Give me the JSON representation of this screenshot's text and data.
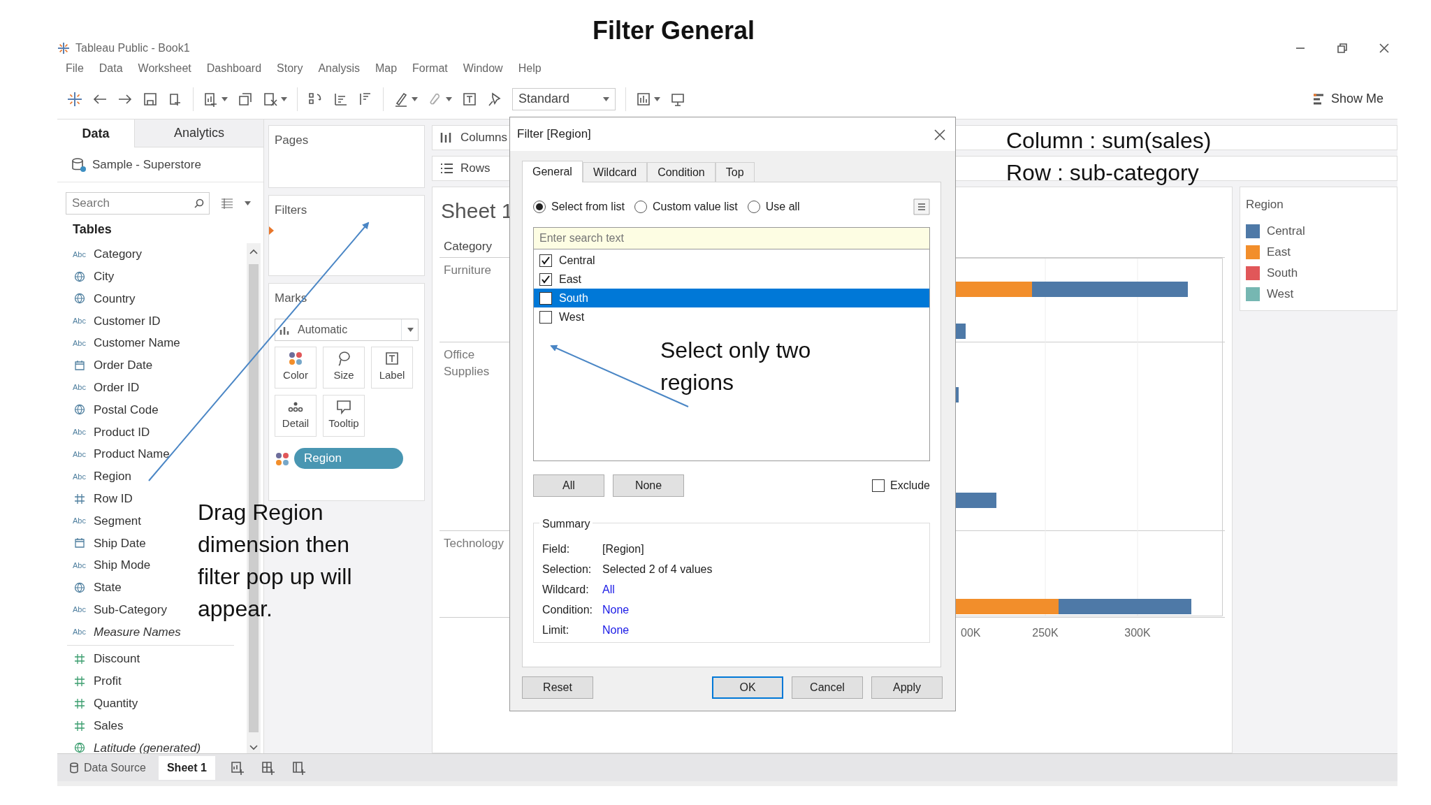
{
  "slide_title": "Filter General",
  "window": {
    "title": "Tableau Public - Book1"
  },
  "menu": [
    "File",
    "Data",
    "Worksheet",
    "Dashboard",
    "Story",
    "Analysis",
    "Map",
    "Format",
    "Window",
    "Help"
  ],
  "toolbar": {
    "mark_size": "Standard",
    "show_me": "Show Me"
  },
  "data_pane": {
    "tabs": [
      {
        "label": "Data",
        "selected": true
      },
      {
        "label": "Analytics",
        "selected": false
      }
    ],
    "data_source": "Sample - Superstore",
    "search": {
      "placeholder": "Search"
    },
    "section": "Tables",
    "fields": [
      {
        "name": "Category",
        "kind": "string",
        "measure": false,
        "badge": "Abc",
        "italic": false
      },
      {
        "name": "City",
        "kind": "geo",
        "measure": false,
        "italic": false
      },
      {
        "name": "Country",
        "kind": "geo",
        "measure": false,
        "italic": false
      },
      {
        "name": "Customer ID",
        "kind": "string",
        "measure": false,
        "badge": "Abc",
        "italic": false
      },
      {
        "name": "Customer Name",
        "kind": "string",
        "measure": false,
        "badge": "Abc",
        "italic": false
      },
      {
        "name": "Order Date",
        "kind": "date",
        "measure": false,
        "italic": false
      },
      {
        "name": "Order ID",
        "kind": "string",
        "measure": false,
        "badge": "Abc",
        "italic": false
      },
      {
        "name": "Postal Code",
        "kind": "geo",
        "measure": false,
        "italic": false
      },
      {
        "name": "Product ID",
        "kind": "string",
        "measure": false,
        "badge": "Abc",
        "italic": false
      },
      {
        "name": "Product Name",
        "kind": "string",
        "measure": false,
        "badge": "Abc",
        "italic": false
      },
      {
        "name": "Region",
        "kind": "string",
        "measure": false,
        "badge": "Abc",
        "italic": false
      },
      {
        "name": "Row ID",
        "kind": "number",
        "measure": false,
        "italic": false
      },
      {
        "name": "Segment",
        "kind": "string",
        "measure": false,
        "badge": "Abc",
        "italic": false
      },
      {
        "name": "Ship Date",
        "kind": "date",
        "measure": false,
        "italic": false
      },
      {
        "name": "Ship Mode",
        "kind": "string",
        "measure": false,
        "badge": "Abc",
        "italic": false
      },
      {
        "name": "State",
        "kind": "geo",
        "measure": false,
        "italic": false
      },
      {
        "name": "Sub-Category",
        "kind": "string",
        "measure": false,
        "badge": "Abc",
        "italic": false
      },
      {
        "name": "Measure Names",
        "kind": "string",
        "measure": false,
        "badge": "Abc",
        "italic": true
      },
      {
        "name": "Discount",
        "kind": "number",
        "measure": true,
        "italic": false
      },
      {
        "name": "Profit",
        "kind": "number",
        "measure": true,
        "italic": false
      },
      {
        "name": "Quantity",
        "kind": "number",
        "measure": true,
        "italic": false
      },
      {
        "name": "Sales",
        "kind": "number",
        "measure": true,
        "italic": false
      },
      {
        "name": "Latitude (generated)",
        "kind": "geo",
        "measure": true,
        "italic": true
      }
    ]
  },
  "cards": {
    "pages": "Pages",
    "filters": "Filters",
    "marks": {
      "title": "Marks",
      "mark_type": "Automatic",
      "buttons": [
        "Color",
        "Size",
        "Label",
        "Detail",
        "Tooltip"
      ],
      "pill": "Region"
    }
  },
  "shelves": [
    "Columns",
    "Rows"
  ],
  "sheet": {
    "title": "Sheet 1",
    "header": "Category",
    "categories": [
      "Furniture",
      "Office Supplies",
      "Technology"
    ],
    "axis_ticks": [
      "00K",
      "250K",
      "300K"
    ]
  },
  "legend": {
    "title": "Region",
    "items": [
      {
        "label": "Central",
        "color": "#4e79a7"
      },
      {
        "label": "East",
        "color": "#f28e2b"
      },
      {
        "label": "South",
        "color": "#e15759"
      },
      {
        "label": "West",
        "color": "#76b7b2"
      }
    ]
  },
  "sheet_tabs": [
    {
      "label": "Data Source",
      "selected": false
    },
    {
      "label": "Sheet 1",
      "selected": true
    }
  ],
  "dialog": {
    "title": "Filter [Region]",
    "tabs": [
      {
        "label": "General",
        "selected": true
      },
      {
        "label": "Wildcard",
        "selected": false
      },
      {
        "label": "Condition",
        "selected": false
      },
      {
        "label": "Top",
        "selected": false
      }
    ],
    "modes": [
      {
        "label": "Select from list",
        "selected": true
      },
      {
        "label": "Custom value list",
        "selected": false
      },
      {
        "label": "Use all",
        "selected": false
      }
    ],
    "search": {
      "placeholder": "Enter search text"
    },
    "values": [
      {
        "label": "Central",
        "checked": true,
        "selected": false
      },
      {
        "label": "East",
        "checked": true,
        "selected": false
      },
      {
        "label": "South",
        "checked": false,
        "selected": true
      },
      {
        "label": "West",
        "checked": false,
        "selected": false
      }
    ],
    "list_buttons": [
      "All",
      "None"
    ],
    "exclude": {
      "label": "Exclude",
      "checked": false
    },
    "summary": {
      "title": "Summary",
      "rows": [
        {
          "label": "Field:",
          "value": "[Region]",
          "link": false
        },
        {
          "label": "Selection:",
          "value": "Selected 2 of 4 values",
          "link": false
        },
        {
          "label": "Wildcard:",
          "value": "All",
          "link": true
        },
        {
          "label": "Condition:",
          "value": "None",
          "link": true
        },
        {
          "label": "Limit:",
          "value": "None",
          "link": true
        }
      ]
    },
    "footer": [
      {
        "label": "Reset",
        "default": false
      },
      {
        "label": "OK",
        "default": true
      },
      {
        "label": "Cancel",
        "default": false
      },
      {
        "label": "Apply",
        "default": false
      }
    ]
  },
  "annotations": {
    "columns_note": "Column : sum(sales)",
    "rows_note": "Row : sub-category",
    "filter_note": "Select only two regions",
    "drag_note": "Drag Region dimension then filter pop up will appear."
  }
}
